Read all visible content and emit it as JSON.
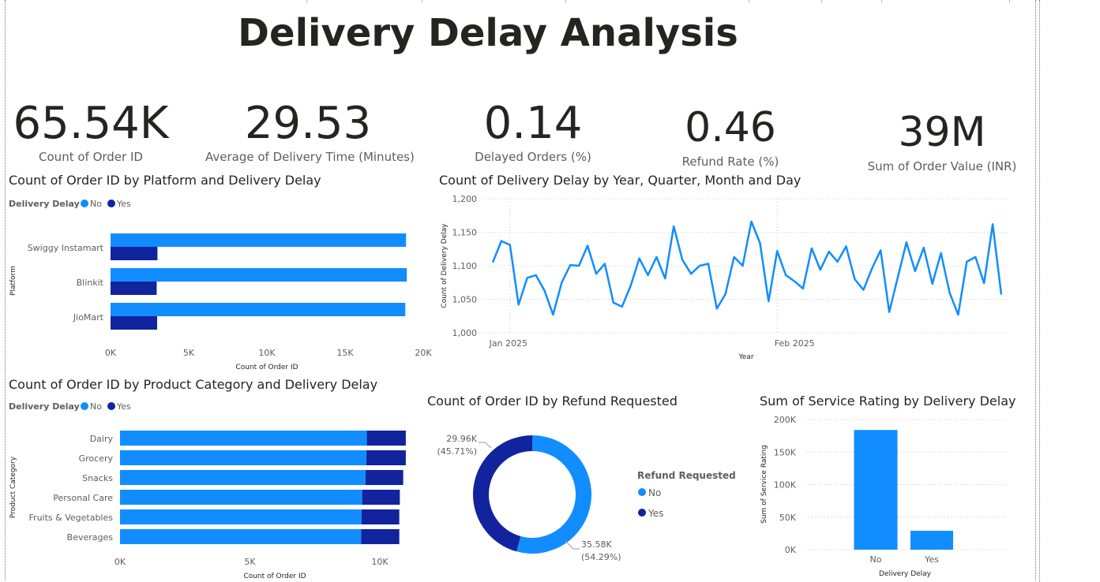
{
  "page_title": "Delivery Delay Analysis",
  "kpis": [
    {
      "value": "65.54K",
      "label": "Count of Order ID"
    },
    {
      "value": "29.53",
      "label": "Average of Delivery Time (Minutes)"
    },
    {
      "value": "0.14",
      "label": "Delayed Orders (%)"
    },
    {
      "value": "0.46",
      "label": "Refund Rate (%)"
    },
    {
      "value": "39M",
      "label": "Sum of Order Value (INR)"
    }
  ],
  "colors": {
    "no": "#118DFF",
    "yes": "#12239E",
    "text": "#252423",
    "muted": "#605e5c"
  },
  "chart_data": [
    {
      "type": "bar",
      "orientation": "horizontal",
      "title": "Count of Order ID by Platform and Delivery Delay",
      "legend_title": "Delivery Delay",
      "legend_position": "top-left",
      "ylabel": "Platform",
      "xlabel": "Count of Order ID",
      "categories": [
        "Swiggy Instamart",
        "Blinkit",
        "JioMart"
      ],
      "series": [
        {
          "name": "No",
          "values": [
            18900,
            18950,
            18850
          ]
        },
        {
          "name": "Yes",
          "values": [
            3000,
            2950,
            2980
          ]
        }
      ],
      "xlim": [
        0,
        20000
      ],
      "xticks": [
        "0K",
        "5K",
        "10K",
        "15K",
        "20K"
      ],
      "grid": false
    },
    {
      "type": "line",
      "title": "Count of Delivery Delay by Year, Quarter, Month and Day",
      "xlabel": "Year",
      "ylabel": "Count of Delivery Delay",
      "ylim": [
        1000,
        1200
      ],
      "yticks": [
        "1,000",
        "1,050",
        "1,100",
        "1,150",
        "1,200"
      ],
      "xticks": [
        "Jan 2025",
        "Feb 2025"
      ],
      "grid": true,
      "x_start": "2024-12-30",
      "values": [
        1105,
        1137,
        1131,
        1042,
        1082,
        1086,
        1063,
        1027,
        1075,
        1101,
        1100,
        1130,
        1088,
        1103,
        1045,
        1039,
        1070,
        1111,
        1086,
        1113,
        1081,
        1159,
        1109,
        1088,
        1100,
        1103,
        1036,
        1058,
        1113,
        1100,
        1166,
        1134,
        1047,
        1122,
        1086,
        1077,
        1066,
        1126,
        1094,
        1121,
        1106,
        1129,
        1080,
        1064,
        1096,
        1123,
        1031,
        1083,
        1135,
        1092,
        1127,
        1073,
        1119,
        1060,
        1027,
        1106,
        1113,
        1074,
        1162,
        1057
      ]
    },
    {
      "type": "bar",
      "orientation": "horizontal",
      "stacked": true,
      "title": "Count of Order ID by Product Category and Delivery Delay",
      "legend_title": "Delivery Delay",
      "legend_position": "top-left",
      "ylabel": "Product Category",
      "xlabel": "Count of Order ID",
      "categories": [
        "Dairy",
        "Grocery",
        "Snacks",
        "Personal Care",
        "Fruits & Vegetables",
        "Beverages"
      ],
      "series": [
        {
          "name": "No",
          "values": [
            9500,
            9480,
            9450,
            9320,
            9300,
            9280
          ]
        },
        {
          "name": "Yes",
          "values": [
            1500,
            1520,
            1450,
            1450,
            1450,
            1470
          ]
        }
      ],
      "xlim": [
        0,
        11000
      ],
      "xticks": [
        "0K",
        "5K",
        "10K"
      ],
      "grid": false
    },
    {
      "type": "pie",
      "donut": true,
      "title": "Count of Order ID by Refund Requested",
      "legend_title": "Refund Requested",
      "legend_position": "right",
      "slices": [
        {
          "name": "No",
          "value": 35580,
          "label": "35.58K",
          "pct": "(54.29%)"
        },
        {
          "name": "Yes",
          "value": 29960,
          "label": "29.96K",
          "pct": "(45.71%)"
        }
      ]
    },
    {
      "type": "bar",
      "title": "Sum of Service Rating by Delivery Delay",
      "xlabel": "Delivery Delay",
      "ylabel": "Sum of Service Rating",
      "categories": [
        "No",
        "Yes"
      ],
      "values": [
        184000,
        29000
      ],
      "ylim": [
        0,
        200000
      ],
      "yticks": [
        "0K",
        "50K",
        "100K",
        "150K",
        "200K"
      ],
      "grid": true
    }
  ]
}
